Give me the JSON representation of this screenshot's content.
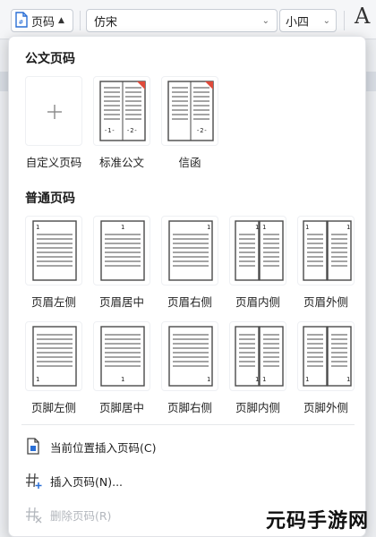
{
  "toolbar": {
    "page_number_label": "页码",
    "font_name": "仿宋",
    "font_size": "小四"
  },
  "panel": {
    "official_section": {
      "title": "公文页码",
      "items": [
        {
          "label": "自定义页码"
        },
        {
          "label": "标准公文",
          "page_numbers": [
            "-1-",
            "-2-"
          ]
        },
        {
          "label": "信函",
          "page_numbers": [
            "-2-"
          ]
        }
      ]
    },
    "normal_section": {
      "title": "普通页码",
      "header_items": [
        {
          "label": "页眉左侧"
        },
        {
          "label": "页眉居中"
        },
        {
          "label": "页眉右侧"
        },
        {
          "label": "页眉内侧"
        },
        {
          "label": "页眉外侧"
        }
      ],
      "footer_items": [
        {
          "label": "页脚左侧"
        },
        {
          "label": "页脚居中"
        },
        {
          "label": "页脚右侧"
        },
        {
          "label": "页脚内侧"
        },
        {
          "label": "页脚外侧"
        }
      ],
      "page_digit": "1"
    },
    "menu": {
      "insert_at_cursor": "当前位置插入页码(C)",
      "insert_page_number": "插入页码(N)...",
      "delete_page_number": "删除页码(R)"
    }
  },
  "watermark": "元码手游网",
  "colors": {
    "corner_marker": "#e04a3a",
    "disabled_text": "#b3b7bd"
  }
}
